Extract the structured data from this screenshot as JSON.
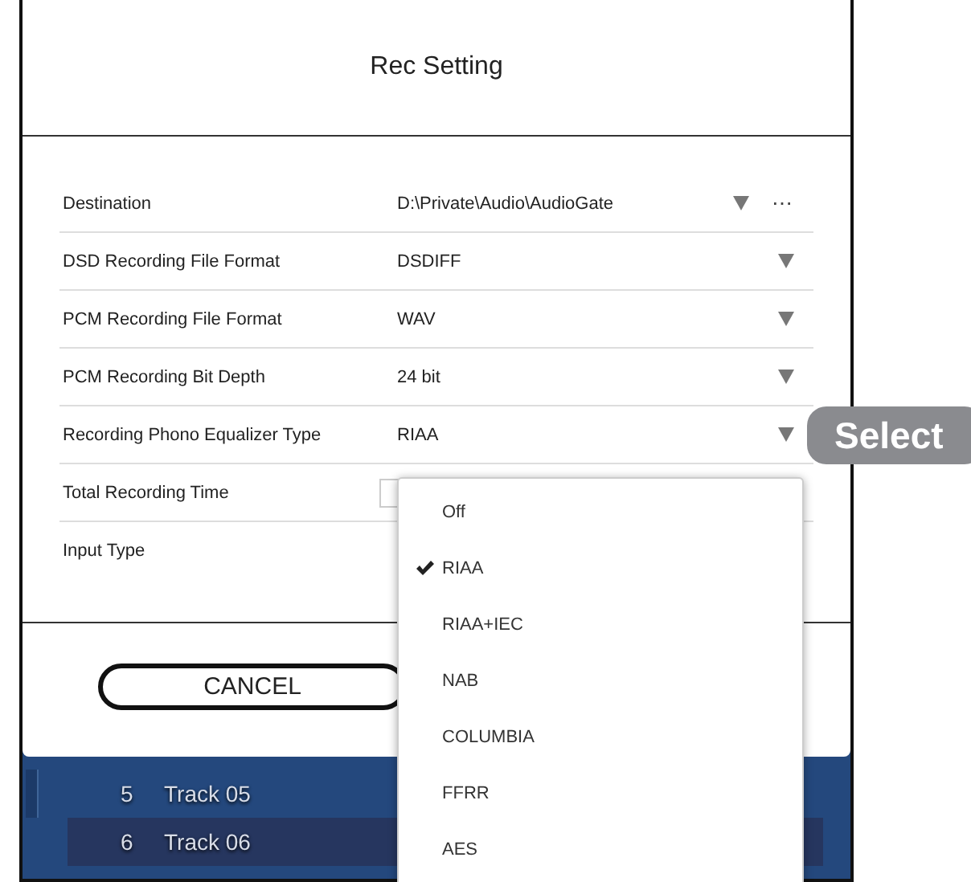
{
  "dialog": {
    "title": "Rec Setting",
    "settings": [
      {
        "label": "Destination",
        "value": "D:\\Private\\Audio\\AudioGate",
        "kind": "path",
        "browse": "⋯"
      },
      {
        "label": "DSD Recording File Format",
        "value": "DSDIFF",
        "kind": "select"
      },
      {
        "label": "PCM Recording File Format",
        "value": "WAV",
        "kind": "select"
      },
      {
        "label": "PCM Recording Bit Depth",
        "value": "24 bit",
        "kind": "select"
      },
      {
        "label": "Recording Phono Equalizer Type",
        "value": "RIAA",
        "kind": "select"
      },
      {
        "label": "Total Recording Time",
        "kind": "field"
      },
      {
        "label": "Input Type",
        "kind": "plain"
      }
    ],
    "buttons": [
      {
        "label": "CANCEL"
      }
    ]
  },
  "menu": {
    "items": [
      {
        "label": "Off",
        "selected": false
      },
      {
        "label": "RIAA",
        "selected": true
      },
      {
        "label": "RIAA+IEC",
        "selected": false
      },
      {
        "label": "NAB",
        "selected": false
      },
      {
        "label": "COLUMBIA",
        "selected": false
      },
      {
        "label": "FFRR",
        "selected": false
      },
      {
        "label": "AES",
        "selected": false
      }
    ]
  },
  "callout": "Select",
  "tracks": [
    {
      "number": "5",
      "title": "Track 05",
      "selected": false
    },
    {
      "number": "6",
      "title": "Track 06",
      "selected": true
    }
  ]
}
